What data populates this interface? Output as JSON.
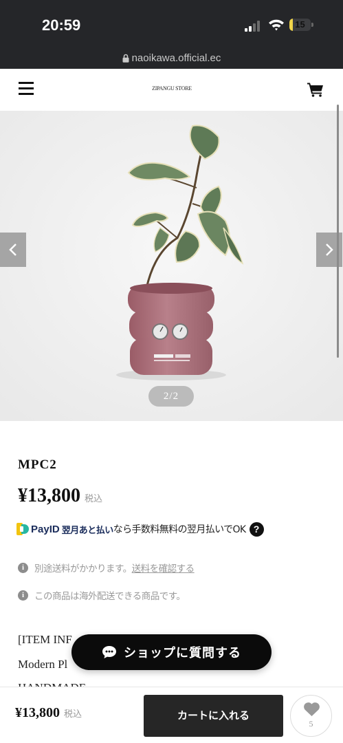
{
  "status_bar": {
    "time": "20:59",
    "battery": "15",
    "battery_level": 0.15,
    "url": "naoikawa.official.ec"
  },
  "header": {
    "logo": "ZIPANGU STORE"
  },
  "gallery": {
    "counter": "2/2"
  },
  "product": {
    "name": "MPC2",
    "price": "¥13,800",
    "tax_label": "税込"
  },
  "payid": {
    "brand": "PayID",
    "later": "翌月あと払い",
    "text": "なら手数料無料の翌月払いでOK",
    "help": "?"
  },
  "shipping": {
    "text": "別途送料がかかります。",
    "link": "送料を確認する"
  },
  "overseas": {
    "text": "この商品は海外配送できる商品です。"
  },
  "description": {
    "lines": [
      "[ITEM INF",
      "Modern Pl",
      "HANDMADE"
    ]
  },
  "chat_button": {
    "label": "ショップに質問する"
  },
  "bottom_bar": {
    "price": "¥13,800",
    "tax_label": "税込",
    "cart_label": "カートに入れる",
    "favorite_count": "5"
  },
  "colors": {
    "status_bar": "#252629",
    "button_dark": "#262626",
    "battery": "#f0d44a",
    "pot": "#b0737e"
  }
}
